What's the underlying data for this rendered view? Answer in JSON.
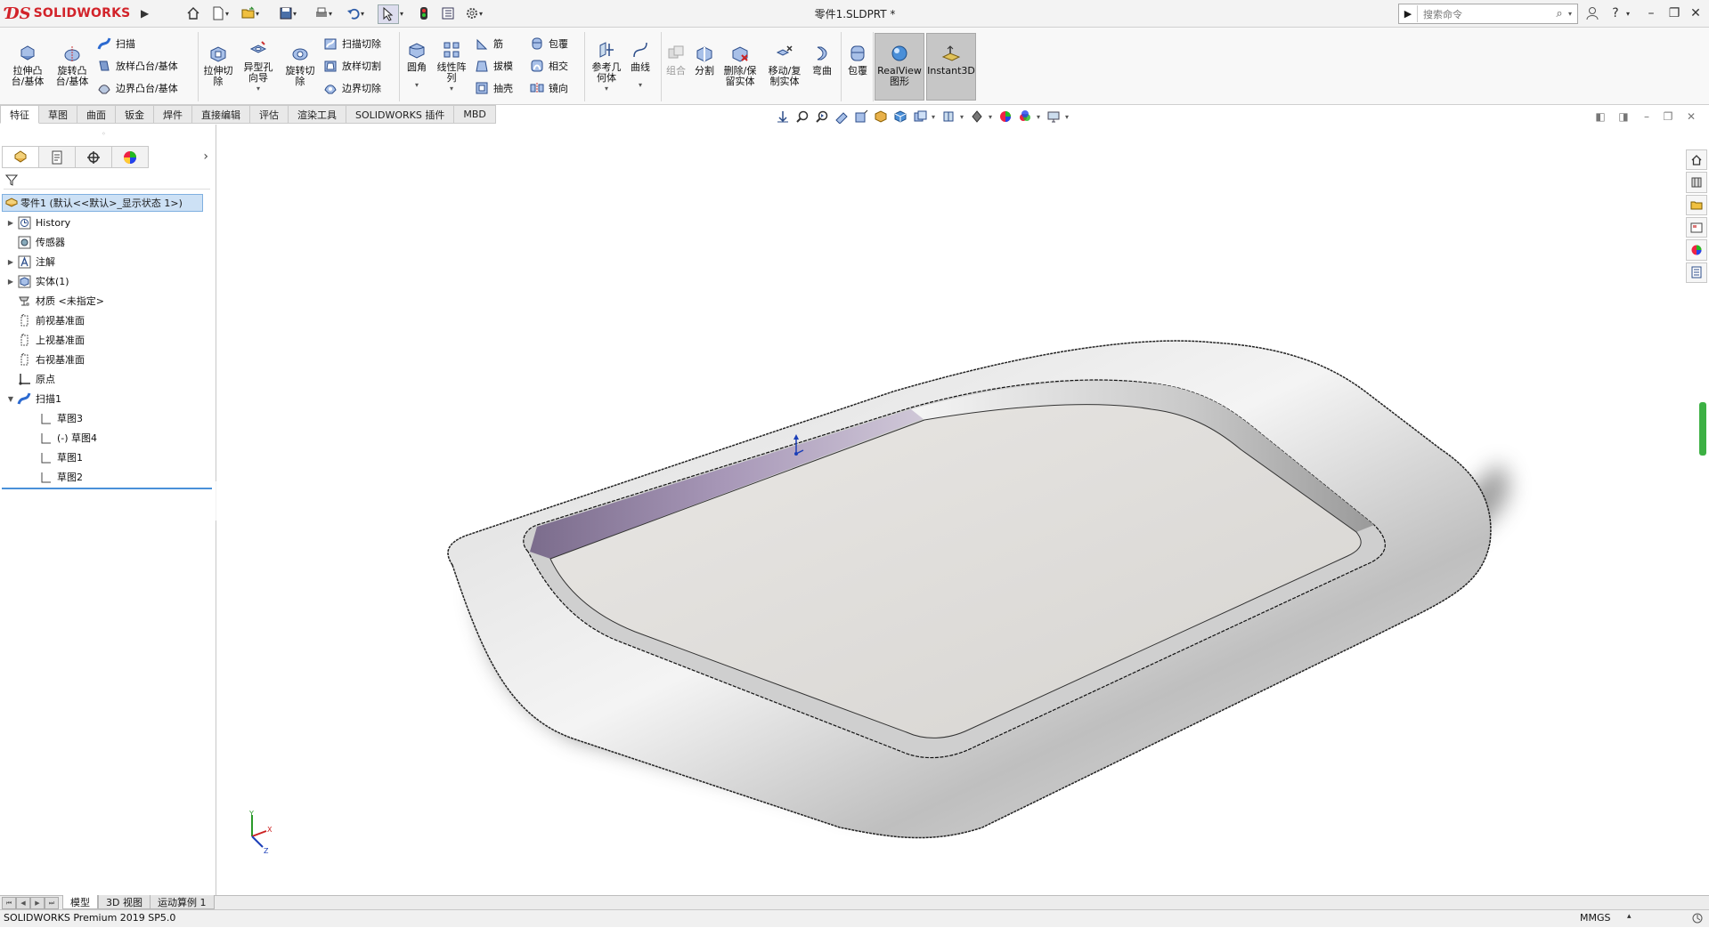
{
  "app": {
    "logo_ds": "ƊS",
    "logo_text": "SOLIDWORKS",
    "document_title": "零件1.SLDPRT *"
  },
  "search": {
    "placeholder": "搜索命令"
  },
  "ribbon": {
    "extrude_boss": "拉伸凸\n台/基体",
    "revolve_boss": "旋转凸\n台/基体",
    "sweep": "扫描",
    "loft_boss": "放样凸台/基体",
    "boundary_boss": "边界凸台/基体",
    "extrude_cut": "拉伸切\n除",
    "hole_wizard": "异型孔\n向导",
    "revolve_cut": "旋转切\n除",
    "sweep_cut": "扫描切除",
    "loft_cut": "放样切割",
    "boundary_cut": "边界切除",
    "fillet": "圆角",
    "linear_pattern": "线性阵\n列",
    "rib": "筋",
    "draft": "拔模",
    "shell": "抽壳",
    "wrap": "包覆",
    "intersect": "相交",
    "mirror": "镜向",
    "ref_geometry": "参考几\n何体",
    "curves": "曲线",
    "combine": "组合",
    "split": "分割",
    "delete_keep_body": "删除/保\n留实体",
    "move_copy_body": "移动/复\n制实体",
    "flex": "弯曲",
    "wrap2": "包覆",
    "realview": "RealView\n图形",
    "instant3d": "Instant3D"
  },
  "tabs": [
    "特征",
    "草图",
    "曲面",
    "钣金",
    "焊件",
    "直接编辑",
    "评估",
    "渲染工具",
    "SOLIDWORKS 插件",
    "MBD"
  ],
  "tree": {
    "root": "零件1 (默认<<默认>_显示状态 1>)",
    "items": [
      {
        "label": "History",
        "icon": "history-icon",
        "expand": true
      },
      {
        "label": "传感器",
        "icon": "sensor-icon",
        "expand": false
      },
      {
        "label": "注解",
        "icon": "annotation-icon",
        "expand": true
      },
      {
        "label": "实体(1)",
        "icon": "solid-bodies-icon",
        "expand": true
      },
      {
        "label": "材质 <未指定>",
        "icon": "material-icon",
        "expand": false
      },
      {
        "label": "前视基准面",
        "icon": "plane-icon",
        "expand": false
      },
      {
        "label": "上视基准面",
        "icon": "plane-icon",
        "expand": false
      },
      {
        "label": "右视基准面",
        "icon": "plane-icon",
        "expand": false
      },
      {
        "label": "原点",
        "icon": "origin-icon",
        "expand": false
      },
      {
        "label": "扫描1",
        "icon": "sweep-feature-icon",
        "expand": true
      },
      {
        "label": "草图3",
        "icon": "sketch-icon"
      },
      {
        "label": "(-) 草图4",
        "icon": "sketch-icon"
      },
      {
        "label": "草图1",
        "icon": "sketch-icon"
      },
      {
        "label": "草图2",
        "icon": "sketch-icon"
      }
    ]
  },
  "bottom_tabs": [
    "模型",
    "3D 视图",
    "运动算例 1"
  ],
  "status": {
    "product": "SOLIDWORKS Premium 2019 SP5.0",
    "units": "MMGS"
  },
  "triad": {
    "x": "X",
    "y": "Y",
    "z": "Z"
  },
  "colors": {
    "brand": "#d2232a",
    "selection": "#cde1f5",
    "accent": "#4a90d9"
  }
}
